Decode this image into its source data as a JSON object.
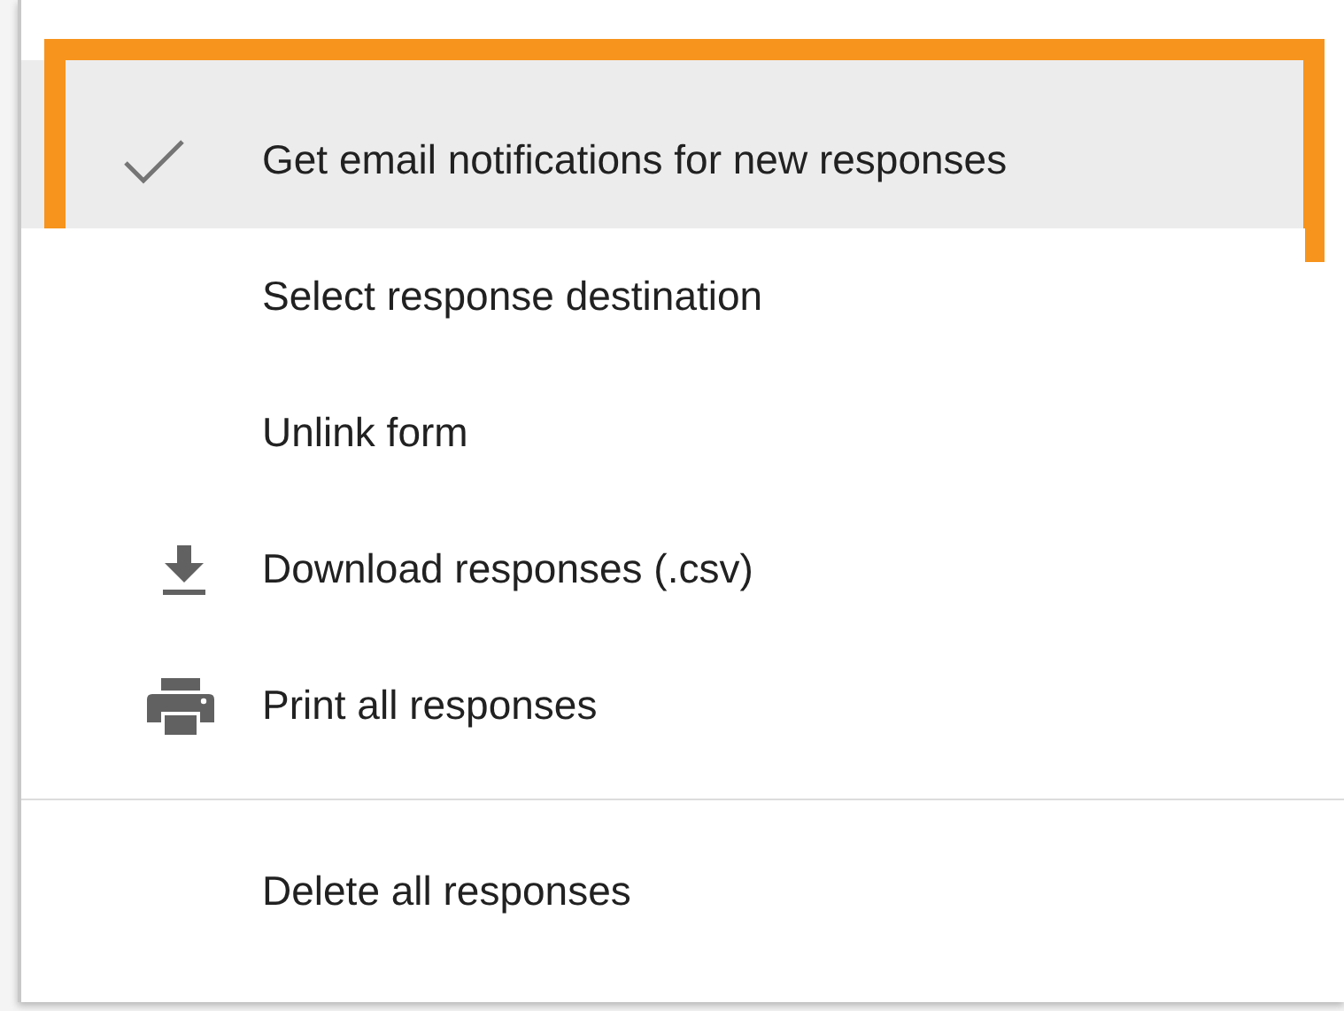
{
  "menu": {
    "sections": [
      {
        "items": [
          {
            "kind": "toggle",
            "label": "Get email notifications for new responses",
            "checked": true,
            "selected": true,
            "outlined": true
          },
          {
            "kind": "plain",
            "label": "Select response destination",
            "selected": false,
            "outlined": false
          },
          {
            "kind": "plain",
            "label": "Unlink form",
            "selected": false,
            "outlined": false
          },
          {
            "kind": "download",
            "label": "Download responses (.csv)",
            "selected": false,
            "outlined": false
          },
          {
            "kind": "print",
            "label": "Print all responses",
            "selected": false,
            "outlined": false
          }
        ]
      },
      {
        "items": [
          {
            "kind": "plain",
            "label": "Delete all responses",
            "selected": false,
            "outlined": false
          }
        ]
      }
    ]
  }
}
